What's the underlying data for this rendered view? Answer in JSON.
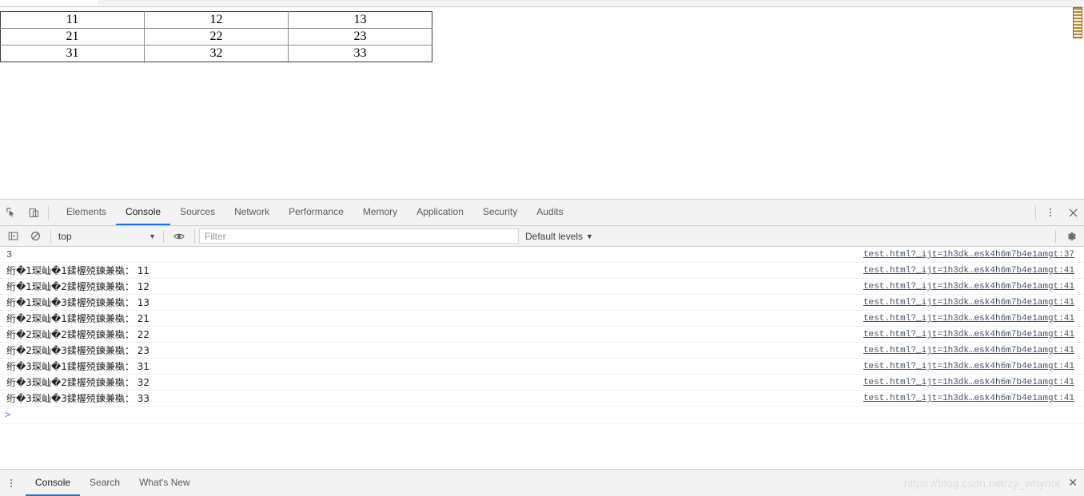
{
  "page": {
    "table": {
      "rows": [
        [
          "11",
          "12",
          "13"
        ],
        [
          "21",
          "22",
          "23"
        ],
        [
          "31",
          "32",
          "33"
        ]
      ]
    }
  },
  "devtools": {
    "tabs": [
      {
        "label": "Elements",
        "active": false
      },
      {
        "label": "Console",
        "active": true
      },
      {
        "label": "Sources",
        "active": false
      },
      {
        "label": "Network",
        "active": false
      },
      {
        "label": "Performance",
        "active": false
      },
      {
        "label": "Memory",
        "active": false
      },
      {
        "label": "Application",
        "active": false
      },
      {
        "label": "Security",
        "active": false
      },
      {
        "label": "Audits",
        "active": false
      }
    ],
    "filterbar": {
      "context": "top",
      "filter_placeholder": "Filter",
      "filter_value": "",
      "levels": "Default levels",
      "caret": "▼"
    },
    "console": {
      "messages": [
        {
          "text": "3",
          "numeric": true,
          "source": "test.html?_ijt=1h3dk…esk4h6m7b4e1amgt:37"
        },
        {
          "text": "绗�1琛屾�1鍒楃殑鍊兼槸： 11",
          "numeric": false,
          "source": "test.html?_ijt=1h3dk…esk4h6m7b4e1amgt:41"
        },
        {
          "text": "绗�1琛屾�2鍒楃殑鍊兼槸： 12",
          "numeric": false,
          "source": "test.html?_ijt=1h3dk…esk4h6m7b4e1amgt:41"
        },
        {
          "text": "绗�1琛屾�3鍒楃殑鍊兼槸： 13",
          "numeric": false,
          "source": "test.html?_ijt=1h3dk…esk4h6m7b4e1amgt:41"
        },
        {
          "text": "绗�2琛屾�1鍒楃殑鍊兼槸： 21",
          "numeric": false,
          "source": "test.html?_ijt=1h3dk…esk4h6m7b4e1amgt:41"
        },
        {
          "text": "绗�2琛屾�2鍒楃殑鍊兼槸： 22",
          "numeric": false,
          "source": "test.html?_ijt=1h3dk…esk4h6m7b4e1amgt:41"
        },
        {
          "text": "绗�2琛屾�3鍒楃殑鍊兼槸： 23",
          "numeric": false,
          "source": "test.html?_ijt=1h3dk…esk4h6m7b4e1amgt:41"
        },
        {
          "text": "绗�3琛屾�1鍒楃殑鍊兼槸： 31",
          "numeric": false,
          "source": "test.html?_ijt=1h3dk…esk4h6m7b4e1amgt:41"
        },
        {
          "text": "绗�3琛屾�2鍒楃殑鍊兼槸： 32",
          "numeric": false,
          "source": "test.html?_ijt=1h3dk…esk4h6m7b4e1amgt:41"
        },
        {
          "text": "绗�3琛屾�3鍒楃殑鍊兼槸： 33",
          "numeric": false,
          "source": "test.html?_ijt=1h3dk…esk4h6m7b4e1amgt:41"
        }
      ],
      "prompt_symbol": ">"
    },
    "drawer": {
      "tabs": [
        {
          "label": "Console",
          "active": true
        },
        {
          "label": "Search",
          "active": false
        },
        {
          "label": "What's New",
          "active": false
        }
      ]
    }
  },
  "watermark": {
    "text": "https://blog.csdn.net/zy_whynot"
  },
  "colors": {
    "accent": "#1a73e8",
    "chrome_bg": "#f3f3f3",
    "border": "#cdcdcd",
    "link": "#44536e",
    "number": "#5b2fa8",
    "prompt": "#4b6fd6",
    "scrollbar_thumb": "#b98b33"
  }
}
